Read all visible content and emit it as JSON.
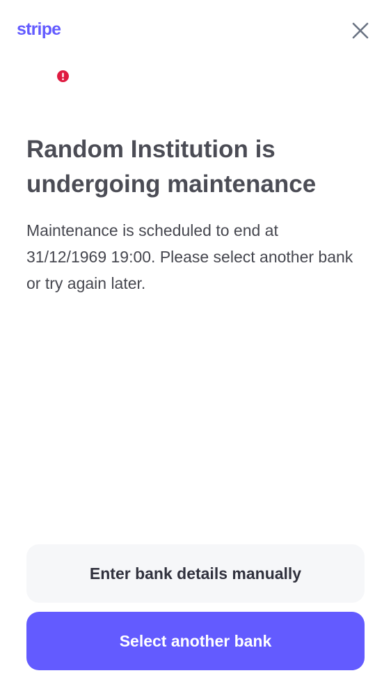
{
  "header": {
    "brand": "stripe",
    "brand_color": "#635bff",
    "close_icon": "close-icon"
  },
  "status": {
    "icon": "error-alert-icon",
    "color": "#df1b41"
  },
  "content": {
    "title": "Random Institution is undergoing maintenance",
    "message": "Maintenance is scheduled to end at 31/12/1969 19:00. Please select another bank or try again later."
  },
  "actions": {
    "manual_label": "Enter bank details manually",
    "select_bank_label": "Select another bank",
    "primary_color": "#635bff"
  }
}
